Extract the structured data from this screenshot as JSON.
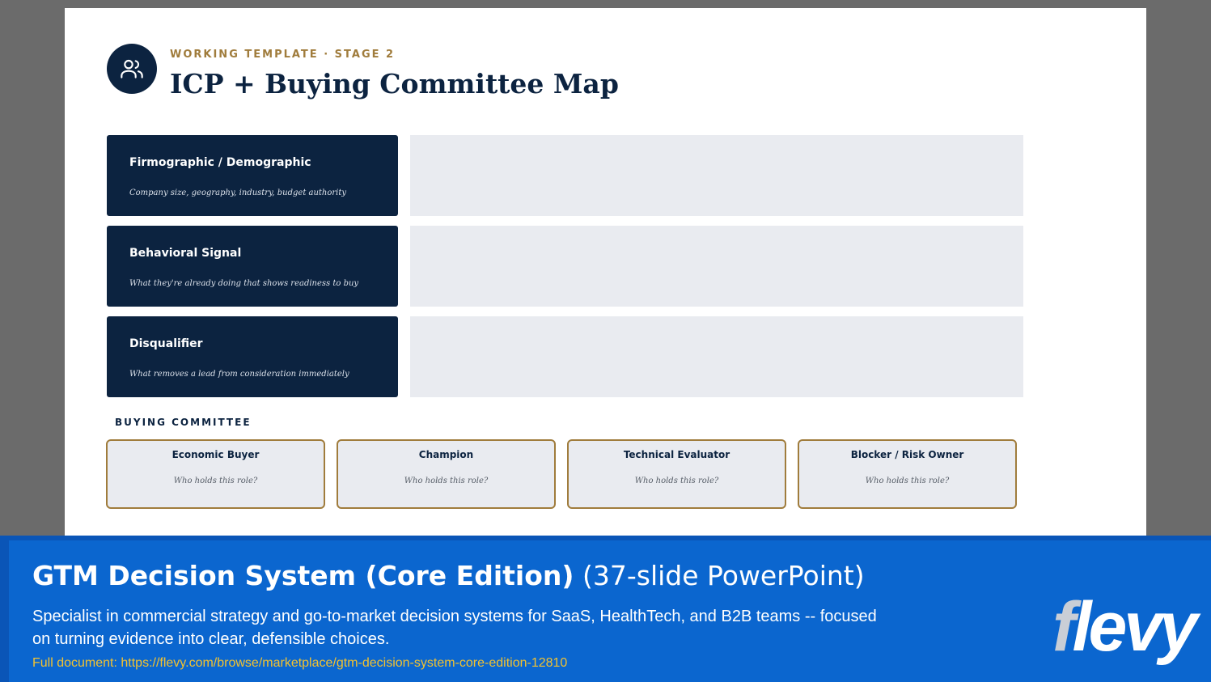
{
  "slide": {
    "kicker": "WORKING TEMPLATE · STAGE 2",
    "title": "ICP + Buying Committee Map",
    "header_icon": "users-icon",
    "rows": [
      {
        "title": "Firmographic / Demographic",
        "description": "Company size, geography, industry, budget authority"
      },
      {
        "title": "Behavioral Signal",
        "description": "What they're already doing that shows readiness to buy"
      },
      {
        "title": "Disqualifier",
        "description": "What removes a lead from consideration immediately"
      }
    ],
    "committee_label": "BUYING COMMITTEE",
    "committee": [
      {
        "role": "Economic Buyer",
        "prompt": "Who holds this role?"
      },
      {
        "role": "Champion",
        "prompt": "Who holds this role?"
      },
      {
        "role": "Technical Evaluator",
        "prompt": "Who holds this role?"
      },
      {
        "role": "Blocker / Risk Owner",
        "prompt": "Who holds this role?"
      }
    ]
  },
  "banner": {
    "title_bold": "GTM Decision System (Core Edition)",
    "title_light": "(37-slide PowerPoint)",
    "description": "Specialist in commercial strategy and go-to-market decision systems for SaaS, HealthTech, and B2B teams -- focused on turning evidence into clear, defensible choices.",
    "link": "Full document: https://flevy.com/browse/marketplace/gtm-decision-system-core-edition-12810",
    "logo_first": "f",
    "logo_rest": "levy"
  },
  "colors": {
    "navy": "#0c2340",
    "gold": "#a07c3c",
    "field": "#e9ebf0",
    "banner_blue": "#0b66cf",
    "link_yellow": "#f2c230"
  }
}
